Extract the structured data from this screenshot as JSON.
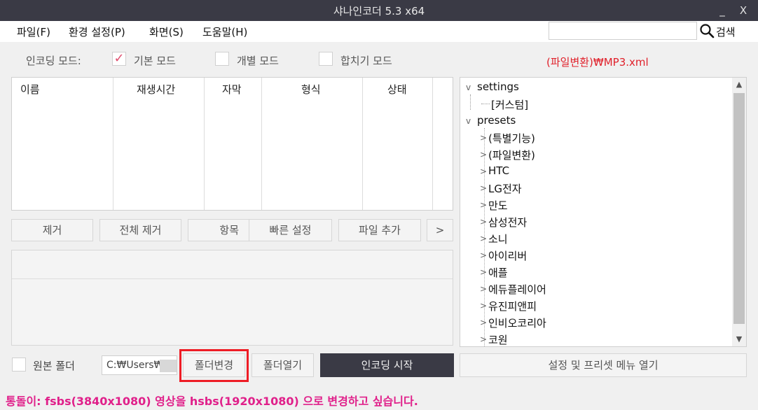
{
  "window": {
    "title": "샤나인코더  5.3  x64",
    "minimize_glyph": "_",
    "close_glyph": "X"
  },
  "menu": {
    "file": "파일(F)",
    "settings": "환경 설정(P)",
    "view": "화면(S)",
    "help": "도움말(H)"
  },
  "search": {
    "value": "",
    "label": "검색",
    "icon": "search-icon"
  },
  "mode": {
    "label": "인코딩 모드:",
    "options": [
      {
        "label": "기본 모드",
        "checked": true
      },
      {
        "label": "개별 모드",
        "checked": false
      },
      {
        "label": "합치기 모드",
        "checked": false
      }
    ],
    "check_glyph": "✓"
  },
  "current_preset": "(파일변환)₩MP3.xml",
  "file_table": {
    "columns": [
      "이름",
      "재생시간",
      "자막",
      "형식",
      "상태"
    ]
  },
  "list_buttons": {
    "remove": "제거",
    "remove_all": "전체 제거",
    "items": "항목",
    "quick_settings": "빠른 설정",
    "add_file": "파일 추가",
    "more": ">"
  },
  "tree": {
    "settings": {
      "label": "settings",
      "children": [
        "[커스텀]"
      ]
    },
    "presets": {
      "label": "presets",
      "children": [
        "(특별기능)",
        "(파일변환)",
        "HTC",
        "LG전자",
        "만도",
        "삼성전자",
        "소니",
        "아이리버",
        "애플",
        "에듀플레이어",
        "유진피앤피",
        "인비오코리아",
        "코원"
      ]
    },
    "expanded_glyph": "v",
    "collapsed_glyph": ">"
  },
  "bottom": {
    "source_folder_label": "원본 폴더",
    "output_path": "C:₩Users₩",
    "change_folder": "폴더변경",
    "open_folder": "폴더열기",
    "start_encoding": "인코딩 시작",
    "open_menu": "설정 및 프리셋 메뉴 열기"
  },
  "status": "통돌이: fsbs(3840x1080) 영상을 hsbs(1920x1080) 으로 변경하고 싶습니다.",
  "colors": {
    "titlebar": "#3a3a45",
    "preset_text": "#e0202a",
    "check": "#e05070",
    "status_text": "#e0208a",
    "highlight": "#ee1c25"
  }
}
